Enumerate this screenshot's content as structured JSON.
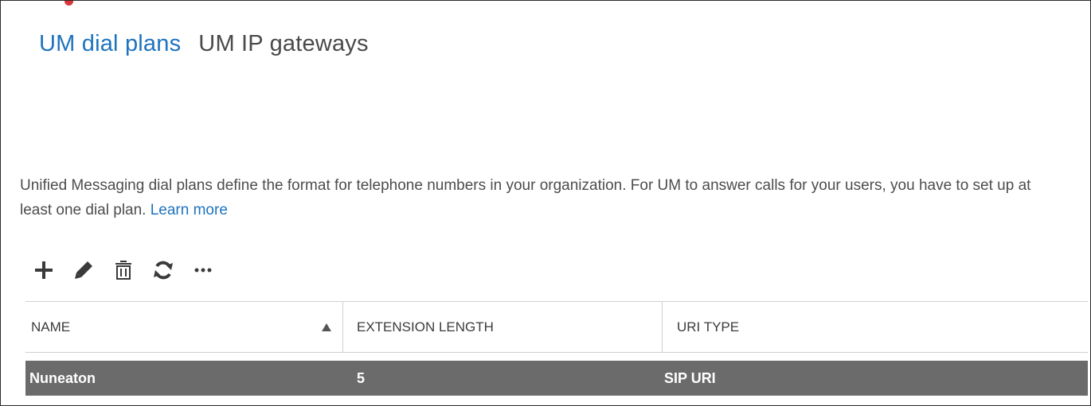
{
  "tabs": [
    {
      "label": "UM dial plans",
      "active": true
    },
    {
      "label": "UM IP gateways",
      "active": false
    }
  ],
  "description": {
    "text": "Unified Messaging dial plans define the format for telephone numbers in your organization. For UM to answer calls for your users, you have to set up at least one dial plan.",
    "link_text": "Learn more"
  },
  "toolbar": {
    "icons": [
      "plus-icon",
      "pencil-icon",
      "trash-icon",
      "refresh-icon",
      "more-icon"
    ],
    "icon_color": "#3a3a3a"
  },
  "table": {
    "columns": [
      "NAME",
      "EXTENSION LENGTH",
      "URI TYPE"
    ],
    "sort_column": "NAME",
    "sort_direction": "ascending",
    "rows": [
      {
        "name": "Nuneaton",
        "extension_length": "5",
        "uri_type": "SIP URI",
        "selected": true
      }
    ]
  },
  "colors": {
    "accent": "#1e73be",
    "selected_row": "#6b6b6b",
    "notification_dot": "#d9343a"
  }
}
